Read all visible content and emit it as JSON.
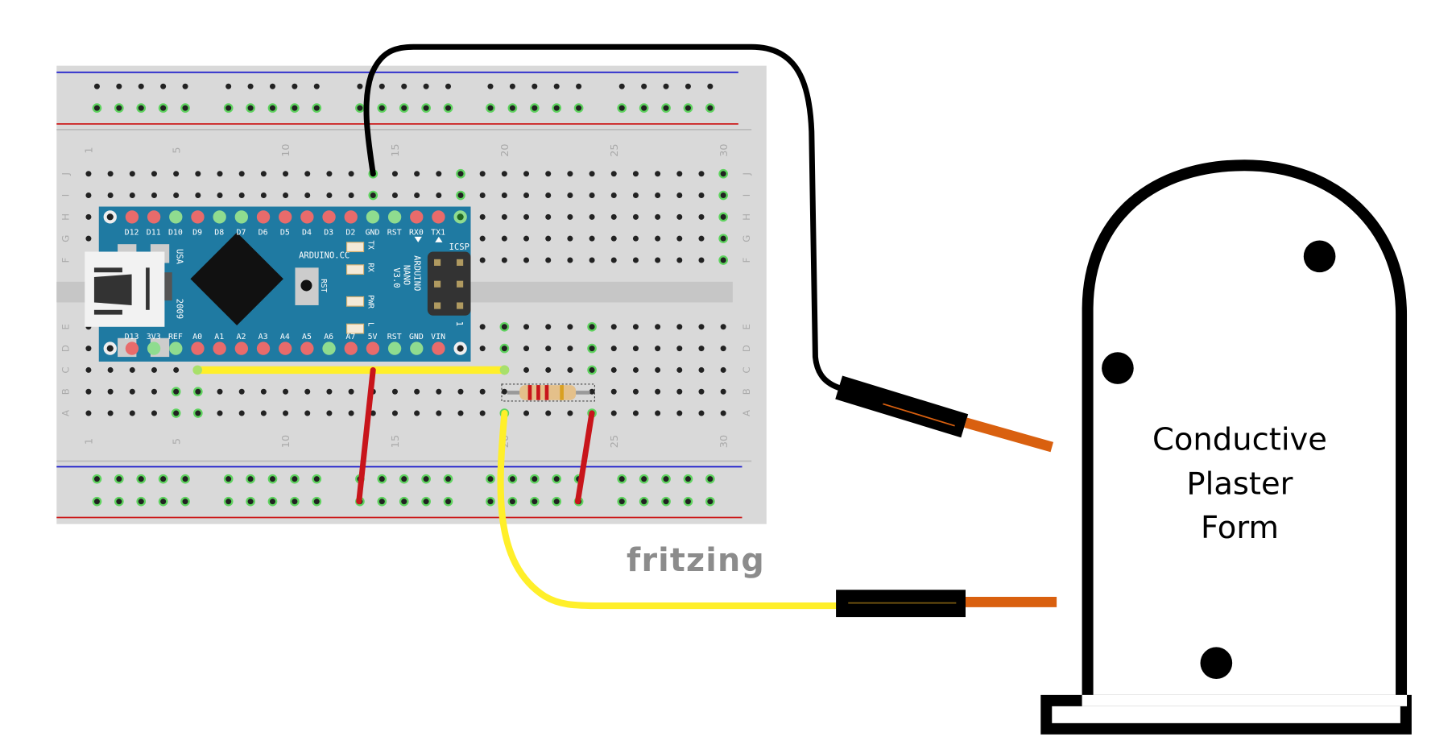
{
  "breadboard": {
    "column_numbers": [
      "1",
      "5",
      "10",
      "15",
      "20",
      "25",
      "30"
    ],
    "row_letters": [
      "J",
      "I",
      "H",
      "G",
      "F",
      "E",
      "D",
      "C",
      "B",
      "A"
    ],
    "colors": {
      "board": "#d9d9d9",
      "rail_blue": "#1a1acc",
      "rail_red": "#cc1a1a",
      "hole": "#222222",
      "hole_active": "#5fd35f"
    }
  },
  "nano": {
    "top_pins": [
      "D12",
      "D11",
      "D10",
      "D9",
      "D8",
      "D7",
      "D6",
      "D5",
      "D4",
      "D3",
      "D2",
      "GND",
      "RST",
      "RX0",
      "TX1"
    ],
    "bottom_pins": [
      "D13",
      "3V3",
      "REF",
      "A0",
      "A1",
      "A2",
      "A3",
      "A4",
      "A5",
      "A6",
      "A7",
      "5V",
      "RST",
      "GND",
      "VIN"
    ],
    "leds": [
      "TX",
      "RX",
      "PWR",
      "L"
    ],
    "brand": "ARDUINO.CC",
    "model_lines": [
      "ARDUINO",
      "NANO",
      "V3.0"
    ],
    "reset_label": "RST",
    "icsp_label": "ICSP",
    "icsp_pin1": "1",
    "usb_text": [
      "USA",
      "2009"
    ],
    "colors": {
      "board": "#1f7aa2",
      "pin_red": "#e86b6b",
      "pin_green": "#8fdc8f"
    }
  },
  "logo": "fritzing",
  "form": {
    "label_lines": [
      "Conductive",
      "Plaster",
      "Form"
    ]
  },
  "wires": {
    "colors": {
      "black": "#000000",
      "yellow": "#ffef2a",
      "red": "#c8151b",
      "orange": "#d9600f"
    }
  }
}
